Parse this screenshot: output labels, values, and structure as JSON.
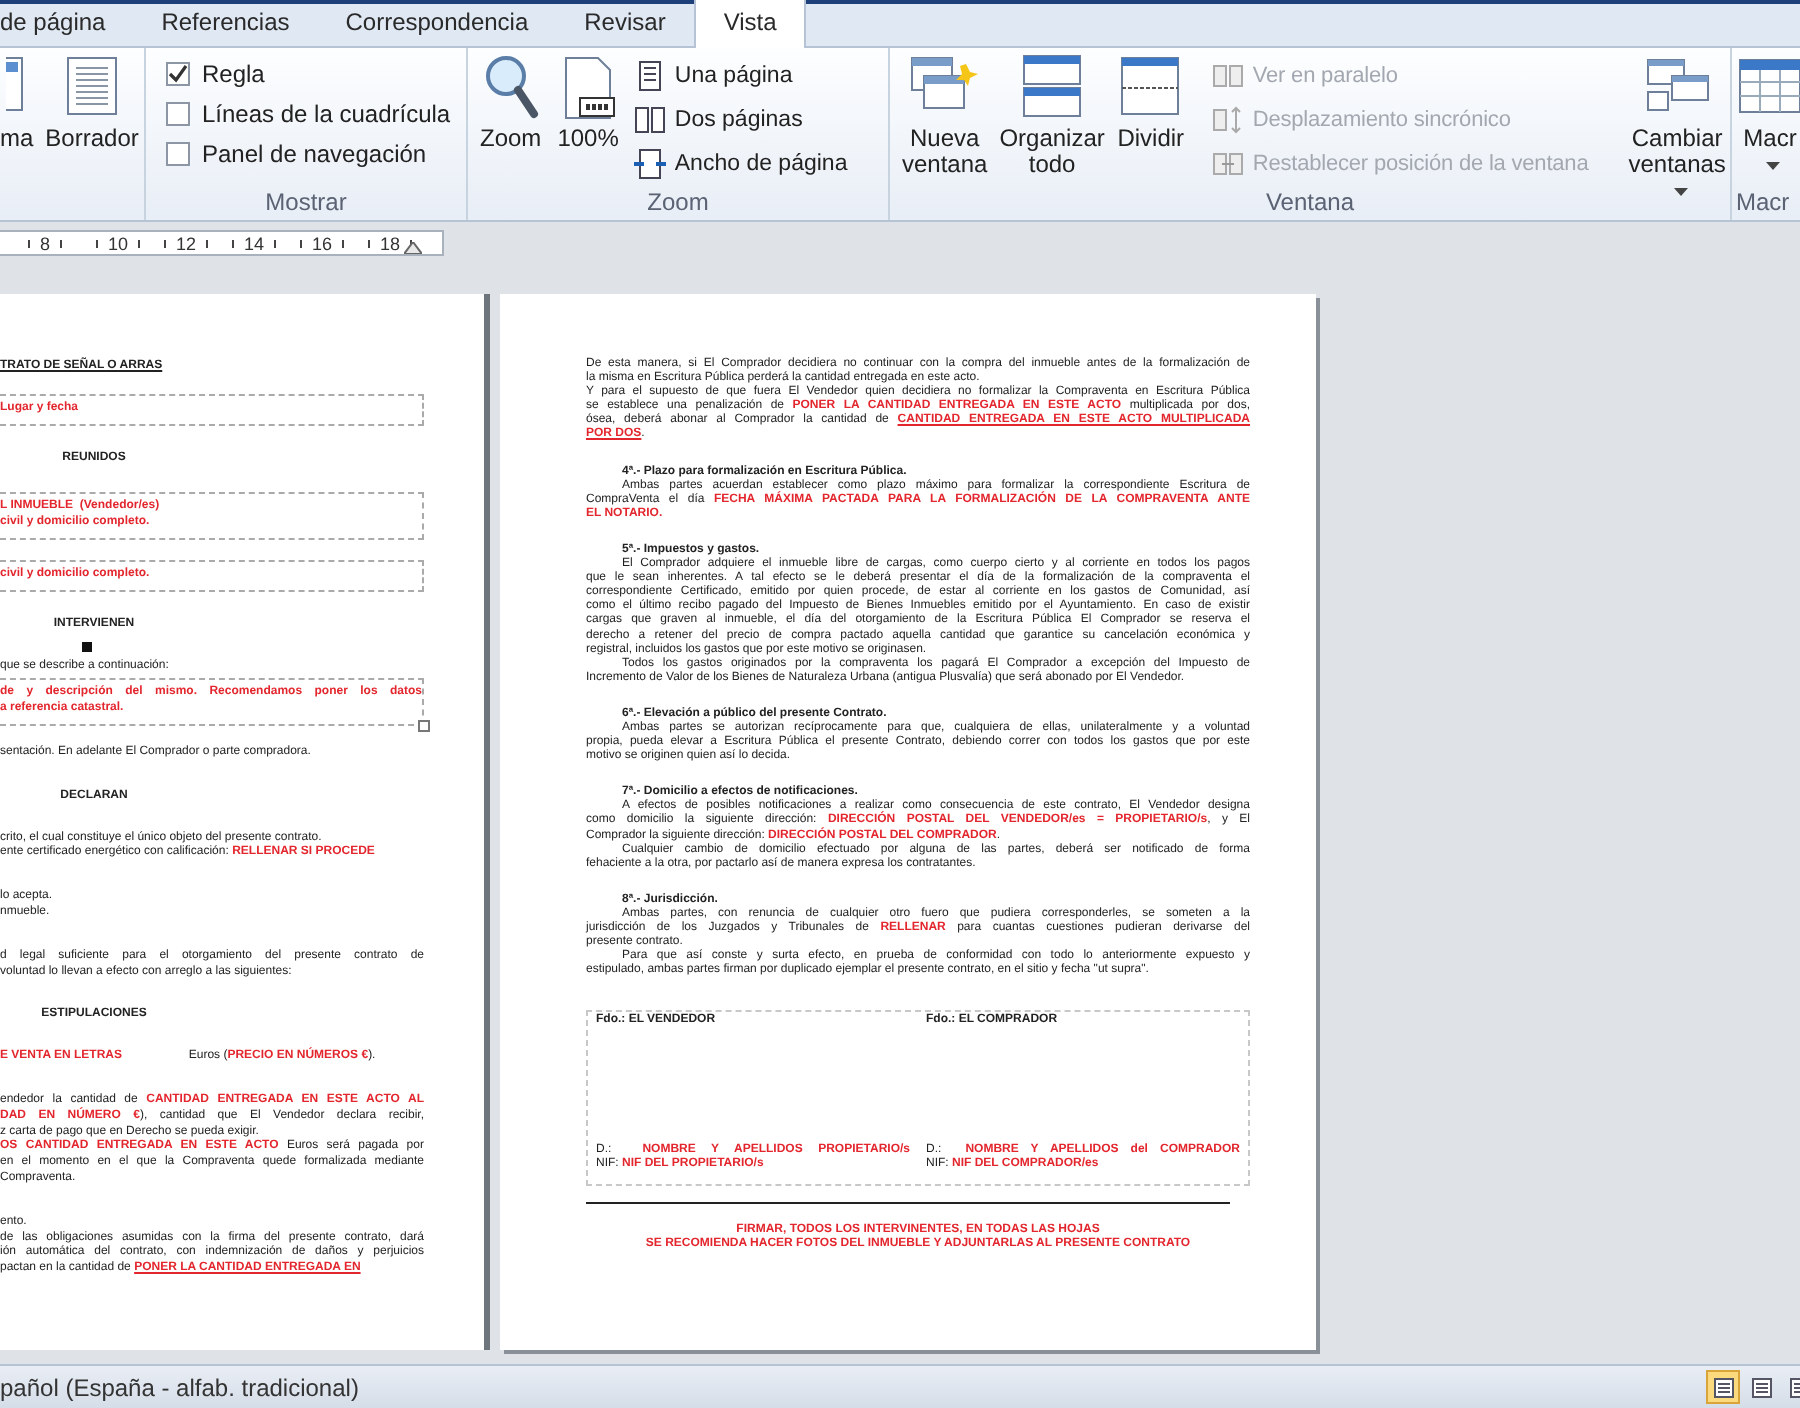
{
  "tabs": [
    {
      "label": "de página",
      "selected": false
    },
    {
      "label": "Referencias",
      "selected": false
    },
    {
      "label": "Correspondencia",
      "selected": false
    },
    {
      "label": "Revisar",
      "selected": false
    },
    {
      "label": "Vista",
      "selected": true
    }
  ],
  "ribbon": {
    "views": {
      "buttons": [
        {
          "label": "ma"
        },
        {
          "label": "Borrador"
        }
      ]
    },
    "show": {
      "label": "Mostrar",
      "checkboxes": [
        {
          "label": "Regla",
          "checked": true
        },
        {
          "label": "Líneas de la cuadrícula",
          "checked": false
        },
        {
          "label": "Panel de navegación",
          "checked": false
        }
      ]
    },
    "zoom": {
      "label": "Zoom",
      "buttons": [
        {
          "label": "Zoom"
        },
        {
          "label": "100%"
        }
      ],
      "small_buttons": [
        {
          "label": "Una página"
        },
        {
          "label": "Dos páginas"
        },
        {
          "label": "Ancho de página"
        }
      ]
    },
    "window": {
      "label": "Ventana",
      "buttons": [
        {
          "label": "Nueva ventana"
        },
        {
          "label": "Organizar todo"
        },
        {
          "label": "Dividir"
        }
      ],
      "small_buttons": [
        {
          "label": "Ver en paralelo",
          "disabled": true
        },
        {
          "label": "Desplazamiento sincrónico",
          "disabled": true
        },
        {
          "label": "Restablecer posición de la ventana",
          "disabled": true
        }
      ],
      "switch_button": {
        "label": "Cambiar ventanas"
      }
    },
    "macros": {
      "label": "Macr",
      "button": {
        "label": "Macr"
      }
    }
  },
  "ruler": {
    "labels": [
      "8",
      "10",
      "12",
      "14",
      "16",
      "18"
    ]
  },
  "left_page": [
    {
      "kind": "title",
      "paragraphs": [
        [
          "TRATO DE SEÑAL O ARRAS"
        ]
      ]
    },
    {
      "kind": "box",
      "selected": false,
      "paragraphs": [
        [
          [
            {
              "text": "Lugar y fecha",
              "kind": "field"
            }
          ]
        ]
      ]
    },
    {
      "kind": "heading",
      "paragraphs": [
        [
          "REUNIDOS"
        ]
      ]
    },
    {
      "kind": "box",
      "selected": false,
      "paragraphs": [
        [
          [
            {
              "text": "L INMUEBLE  (Vendedor/es)",
              "kind": "field"
            }
          ]
        ],
        [
          [
            {
              "text": "civil y domicilio completo.",
              "kind": "field"
            }
          ]
        ]
      ]
    },
    {
      "kind": "box",
      "selected": false,
      "paragraphs": [
        [
          [
            {
              "text": "civil y domicilio completo.",
              "kind": "field"
            }
          ]
        ]
      ]
    },
    {
      "kind": "heading",
      "paragraphs": [
        [
          "INTERVIENEN"
        ]
      ]
    },
    {
      "kind": "anchor"
    },
    {
      "kind": "text",
      "paragraphs": [
        [
          "que se describe a continuación:"
        ]
      ]
    },
    {
      "kind": "box",
      "selected": true,
      "paragraphs": [
        [
          [
            {
              "text": "de y descripción del mismo. Recomendamos poner los datos",
              "kind": "field"
            }
          ],
          [
            {
              "text": "a referencia catastral.",
              "kind": "field"
            }
          ]
        ]
      ]
    },
    {
      "kind": "text",
      "paragraphs": [
        [
          "sentación. En adelante El Comprador o parte compradora."
        ]
      ]
    },
    {
      "kind": "heading",
      "paragraphs": [
        [
          "DECLARAN"
        ]
      ]
    },
    {
      "kind": "text",
      "paragraphs": [
        [
          "crito, el cual constituye el único objeto del presente contrato."
        ],
        [
          [
            {
              "text": "ente certificado energético con calificación: ",
              "kind": "plain"
            },
            {
              "text": "RELLENAR SI PROCEDE",
              "kind": "field"
            }
          ]
        ]
      ]
    },
    {
      "kind": "text",
      "paragraphs": [
        [
          "lo acepta."
        ],
        [
          "nmueble."
        ]
      ]
    },
    {
      "kind": "text",
      "paragraphs": [
        [
          "d legal suficiente para el otorgamiento del presente contrato de",
          "voluntad lo llevan a efecto con arreglo a las siguientes:"
        ]
      ]
    },
    {
      "kind": "heading",
      "paragraphs": [
        [
          "ESTIPULACIONES"
        ]
      ]
    },
    {
      "kind": "text",
      "paragraphs": [
        [
          [
            {
              "text": "E VENTA EN LETRAS",
              "kind": "field"
            },
            {
              "text": "                    Euros (",
              "kind": "plain"
            },
            {
              "text": "PRECIO EN NÚMEROS €",
              "kind": "field"
            },
            {
              "text": ").",
              "kind": "plain"
            }
          ]
        ]
      ]
    },
    {
      "kind": "text",
      "paragraphs": [
        [
          [
            {
              "text": "endedor la cantidad de ",
              "kind": "plain"
            },
            {
              "text": "CANTIDAD ENTREGADA EN ESTE ACTO AL",
              "kind": "field"
            }
          ],
          [
            {
              "text": "DAD EN NÚMERO €",
              "kind": "field"
            },
            {
              "text": "), cantidad que El Vendedor declara recibir,",
              "kind": "plain"
            }
          ],
          "z carta de pago que en Derecho se pueda exigir."
        ],
        [
          [
            {
              "text": "OS CANTIDAD ENTREGADA EN ESTE ACTO",
              "kind": "field"
            },
            {
              "text": " Euros será pagada por",
              "kind": "plain"
            }
          ],
          "en el momento en el que la Compraventa quede formalizada mediante",
          "Compraventa."
        ]
      ]
    },
    {
      "kind": "text",
      "paragraphs": [
        [
          "ento."
        ],
        [
          "de las obligaciones asumidas con la firma del presente contrato, dará",
          "ión automática del contrato, con indemnización de daños y perjuicios",
          [
            {
              "text": "pactan en la cantidad de ",
              "kind": "plain"
            },
            {
              "text": "PONER LA CANTIDAD ENTREGADA EN",
              "kind": "field-underlined"
            }
          ]
        ]
      ]
    }
  ],
  "right_page": [
    {
      "kind": "text",
      "paragraphs": [
        [
          "De esta manera, si El Comprador decidiera no continuar con la compra del inmueble antes de la formalización de",
          "la misma en Escritura Pública perderá la cantidad entregada en este acto."
        ],
        [
          "Y para el supuesto de que fuera El Vendedor quien decidiera no formalizar la Compraventa en Escritura Pública",
          [
            {
              "text": "se establece una penalización de ",
              "kind": "plain"
            },
            {
              "text": "PONER LA CANTIDAD ENTREGADA EN ESTE ACTO",
              "kind": "field"
            },
            {
              "text": " multiplicada por dos,",
              "kind": "plain"
            }
          ],
          [
            {
              "text": "ósea, deberá abonar al Comprador la cantidad de ",
              "kind": "plain"
            },
            {
              "text": "CANTIDAD ENTREGADA EN ESTE ACTO MULTIPLICADA",
              "kind": "field-underlined"
            }
          ],
          [
            {
              "text": "POR DOS",
              "kind": "field-underlined"
            },
            {
              "text": ".",
              "kind": "plain"
            }
          ]
        ]
      ]
    },
    {
      "kind": "heading",
      "paragraphs": [
        [
          "4ª.- Plazo para formalización en Escritura Pública."
        ]
      ]
    },
    {
      "kind": "indented",
      "paragraphs": [
        [
          "Ambas partes acuerdan establecer como plazo máximo para formalizar la correspondiente Escritura de",
          [
            {
              "text": "CompraVenta el día ",
              "kind": "plain"
            },
            {
              "text": "FECHA MÁXIMA PACTADA PARA LA FORMALIZACIÓN DE LA COMPRAVENTA ANTE",
              "kind": "field"
            }
          ],
          [
            {
              "text": "EL NOTARIO.",
              "kind": "field"
            }
          ]
        ]
      ]
    },
    {
      "kind": "heading",
      "paragraphs": [
        [
          "5ª.- Impuestos y gastos."
        ]
      ]
    },
    {
      "kind": "indented",
      "paragraphs": [
        [
          "El Comprador adquiere el inmueble libre de cargas, como cuerpo cierto y al corriente en todos los pagos",
          "que le sean inherentes. A tal efecto se le deberá presentar el día de la formalización de la compraventa el",
          "correspondiente Certificado, emitido por quien procede, de estar al corriente en los gastos de Comunidad, así",
          "como el último recibo pagado del Impuesto de Bienes Inmuebles emitido por el Ayuntamiento. En caso de existir",
          "cargas que graven al inmueble, el día del otorgamiento de la Escritura Pública El Comprador se reserva el",
          "derecho a retener del precio de compra pactado aquella cantidad que garantice su cancelación económica y",
          "registral, incluidos los gastos que por este motivo se originasen."
        ],
        [
          "Todos los gastos originados por la compraventa los pagará El Comprador a excepción del Impuesto de",
          "Incremento de Valor de los Bienes de Naturaleza Urbana (antigua Plusvalía) que será abonado por El Vendedor."
        ]
      ]
    },
    {
      "kind": "heading",
      "paragraphs": [
        [
          "6ª.- Elevación a público del presente Contrato."
        ]
      ]
    },
    {
      "kind": "indented",
      "paragraphs": [
        [
          "Ambas partes se autorizan recíprocamente para que, cualquiera de ellas, unilateralmente y a voluntad",
          "propia, pueda elevar a Escritura Pública el presente Contrato, debiendo correr con todos los gastos que por este",
          "motivo se originen quien así lo decida."
        ]
      ]
    },
    {
      "kind": "heading",
      "paragraphs": [
        [
          "7ª.- Domicilio a efectos de notificaciones."
        ]
      ]
    },
    {
      "kind": "indented",
      "paragraphs": [
        [
          "A efectos de posibles notificaciones a realizar como consecuencia de este contrato, El Vendedor designa",
          [
            {
              "text": "como domicilio la siguiente dirección: ",
              "kind": "plain"
            },
            {
              "text": "DIRECCIÓN POSTAL DEL VENDEDOR/es = PROPIETARIO/s",
              "kind": "field"
            },
            {
              "text": ", y El",
              "kind": "plain"
            }
          ],
          [
            {
              "text": "Comprador la siguiente dirección: ",
              "kind": "plain"
            },
            {
              "text": "DIRECCIÓN POSTAL DEL COMPRADOR",
              "kind": "field"
            },
            {
              "text": ".",
              "kind": "plain"
            }
          ]
        ],
        [
          "Cualquier cambio de domicilio efectuado por alguna de las partes, deberá ser notificado de forma",
          "fehaciente a la otra, por pactarlo así de manera expresa los contratantes."
        ]
      ]
    },
    {
      "kind": "heading",
      "paragraphs": [
        [
          "8ª.- Jurisdicción."
        ]
      ]
    },
    {
      "kind": "indented",
      "paragraphs": [
        [
          "Ambas partes, con renuncia de cualquier otro fuero que pudiera corresponderles, se someten a la",
          [
            {
              "text": "jurisdicción de los Juzgados y Tribunales de ",
              "kind": "plain"
            },
            {
              "text": "RELLENAR",
              "kind": "field"
            },
            {
              "text": " para cuantas cuestiones pudieran derivarse del",
              "kind": "plain"
            }
          ],
          "presente contrato."
        ],
        [
          "Para que así conste y surta efecto, en prueba de conformidad con todo lo anteriormente expuesto y",
          "estipulado, ambas partes firman por duplicado ejemplar el presente contrato, en el sitio y fecha \"ut supra\"."
        ]
      ]
    },
    {
      "kind": "signatures",
      "signers": [
        {
          "label": "Fdo.: EL VENDEDOR",
          "lines": [
            [
              {
                "text": "D.:  ",
                "kind": "plain"
              },
              {
                "text": "NOMBRE Y APELLIDOS PROPIETARIO/s",
                "kind": "field"
              }
            ],
            [
              {
                "text": "NIF: ",
                "kind": "plain"
              },
              {
                "text": "NIF DEL PROPIETARIO/s",
                "kind": "field"
              }
            ]
          ]
        },
        {
          "label": "Fdo.: EL COMPRADOR",
          "lines": [
            [
              {
                "text": "D.:  ",
                "kind": "plain"
              },
              {
                "text": "NOMBRE Y APELLIDOS del COMPRADOR",
                "kind": "field"
              }
            ],
            [
              {
                "text": "NIF: ",
                "kind": "plain"
              },
              {
                "text": "NIF DEL COMPRADOR/es",
                "kind": "field"
              }
            ]
          ]
        }
      ]
    },
    {
      "kind": "rule"
    },
    {
      "kind": "note",
      "paragraphs": [
        [
          "FIRMAR, TODOS LOS INTERVINENTES, EN TODAS LAS HOJAS",
          "SE RECOMIENDA HACER FOTOS DEL INMUEBLE Y ADJUNTARLAS AL PRESENTE CONTRATO"
        ]
      ]
    }
  ],
  "status_bar": {
    "language": "pañol (España - alfab. tradicional)",
    "view_buttons": [
      {
        "selected": true
      },
      {
        "selected": false
      },
      {
        "selected": false
      }
    ]
  }
}
